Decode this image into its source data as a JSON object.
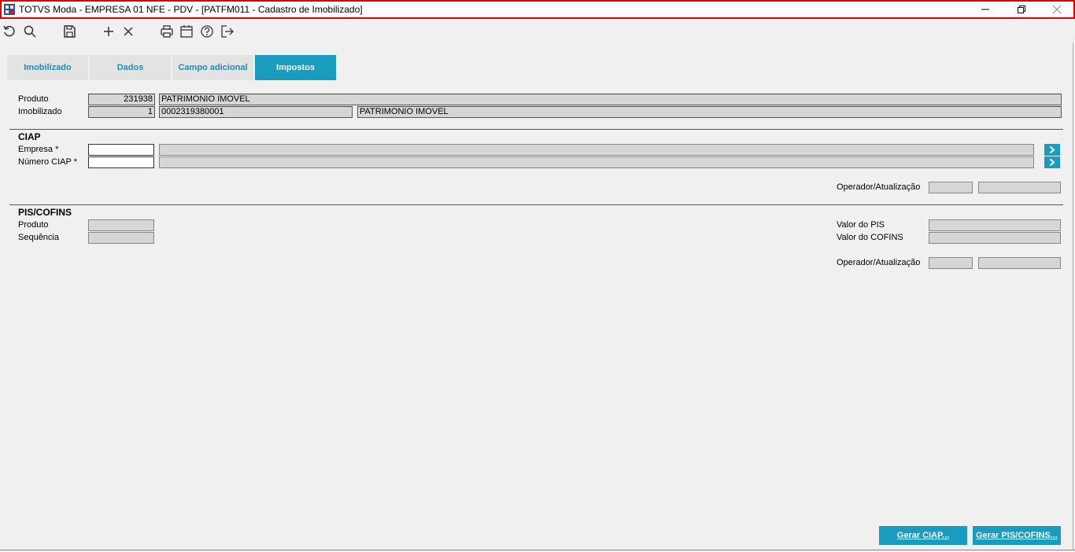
{
  "window": {
    "title": "TOTVS Moda - EMPRESA 01 NFE - PDV - [PATFM011 - Cadastro de Imobilizado]"
  },
  "toolbar": {
    "buttons": [
      "refresh-icon",
      "search-icon",
      "save-icon",
      "add-icon",
      "delete-icon",
      "print-icon",
      "calendar-icon",
      "help-icon",
      "exit-icon"
    ]
  },
  "tabs": [
    {
      "label": "Imobilizado",
      "active": false
    },
    {
      "label": "Dados",
      "active": false
    },
    {
      "label": "Campo adicional",
      "active": false
    },
    {
      "label": "Impostos",
      "active": true
    }
  ],
  "header": {
    "produto_label": "Produto",
    "produto_code": "231938",
    "produto_desc": "PATRIMONIO IMOVEL",
    "imobilizado_label": "Imobilizado",
    "imobilizado_num": "1",
    "imobilizado_code": "0002319380001",
    "imobilizado_desc": "PATRIMONIO IMOVEL"
  },
  "ciap": {
    "section_title": "CIAP",
    "empresa_label": "Empresa *",
    "empresa_value": "",
    "empresa_desc": "",
    "numero_label": "Número CIAP *",
    "numero_value": "",
    "numero_desc": "",
    "operador_label": "Operador/Atualização",
    "operador_value": "",
    "atualizacao_value": ""
  },
  "pis_cofins": {
    "section_title": "PIS/COFINS",
    "produto_label": "Produto",
    "produto_value": "",
    "sequencia_label": "Sequência",
    "sequencia_value": "",
    "valor_pis_label": "Valor do PIS",
    "valor_pis_value": "",
    "valor_cofins_label": "Valor do COFINS",
    "valor_cofins_value": "",
    "operador_label": "Operador/Atualização",
    "operador_value": "",
    "atualizacao_value": ""
  },
  "actions": {
    "gerar_ciap": "Gerar CIAP...",
    "gerar_pis_cofins": "Gerar PIS/COFINS..."
  },
  "colors": {
    "accent": "#1a9bc0",
    "tab_inactive_text": "#1a8fb8",
    "title_border": "#e00000"
  }
}
